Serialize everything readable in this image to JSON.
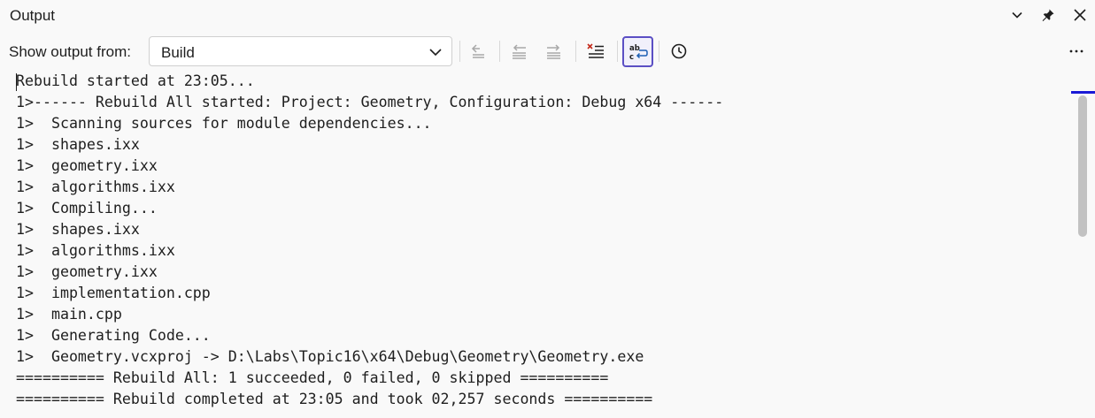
{
  "panel": {
    "title": "Output"
  },
  "toolbar": {
    "show_output_label": "Show output from:",
    "source_selected": "Build"
  },
  "output_lines": [
    "Rebuild started at 23:05...",
    "1>------ Rebuild All started: Project: Geometry, Configuration: Debug x64 ------",
    "1>  Scanning sources for module dependencies...",
    "1>  shapes.ixx",
    "1>  geometry.ixx",
    "1>  algorithms.ixx",
    "1>  Compiling...",
    "1>  shapes.ixx",
    "1>  algorithms.ixx",
    "1>  geometry.ixx",
    "1>  implementation.cpp",
    "1>  main.cpp",
    "1>  Generating Code...",
    "1>  Geometry.vcxproj -> D:\\Labs\\Topic16\\x64\\Debug\\Geometry\\Geometry.exe",
    "========== Rebuild All: 1 succeeded, 0 failed, 0 skipped ==========",
    "========== Rebuild completed at 23:05 and took 02,257 seconds =========="
  ],
  "colors": {
    "accent": "#5b4fc4",
    "scroll_marker": "#1a1ad6",
    "clear_red": "#c42b1c"
  },
  "icons": {
    "chevron": "chevron-down-icon",
    "pin": "pin-icon",
    "close": "close-icon",
    "find_message": "find-message-icon",
    "prev_message": "previous-message-icon",
    "next_message": "next-message-icon",
    "clear_all": "clear-all-icon",
    "word_wrap": "word-wrap-icon",
    "timestamp": "clock-icon",
    "more": "more-options-icon"
  }
}
